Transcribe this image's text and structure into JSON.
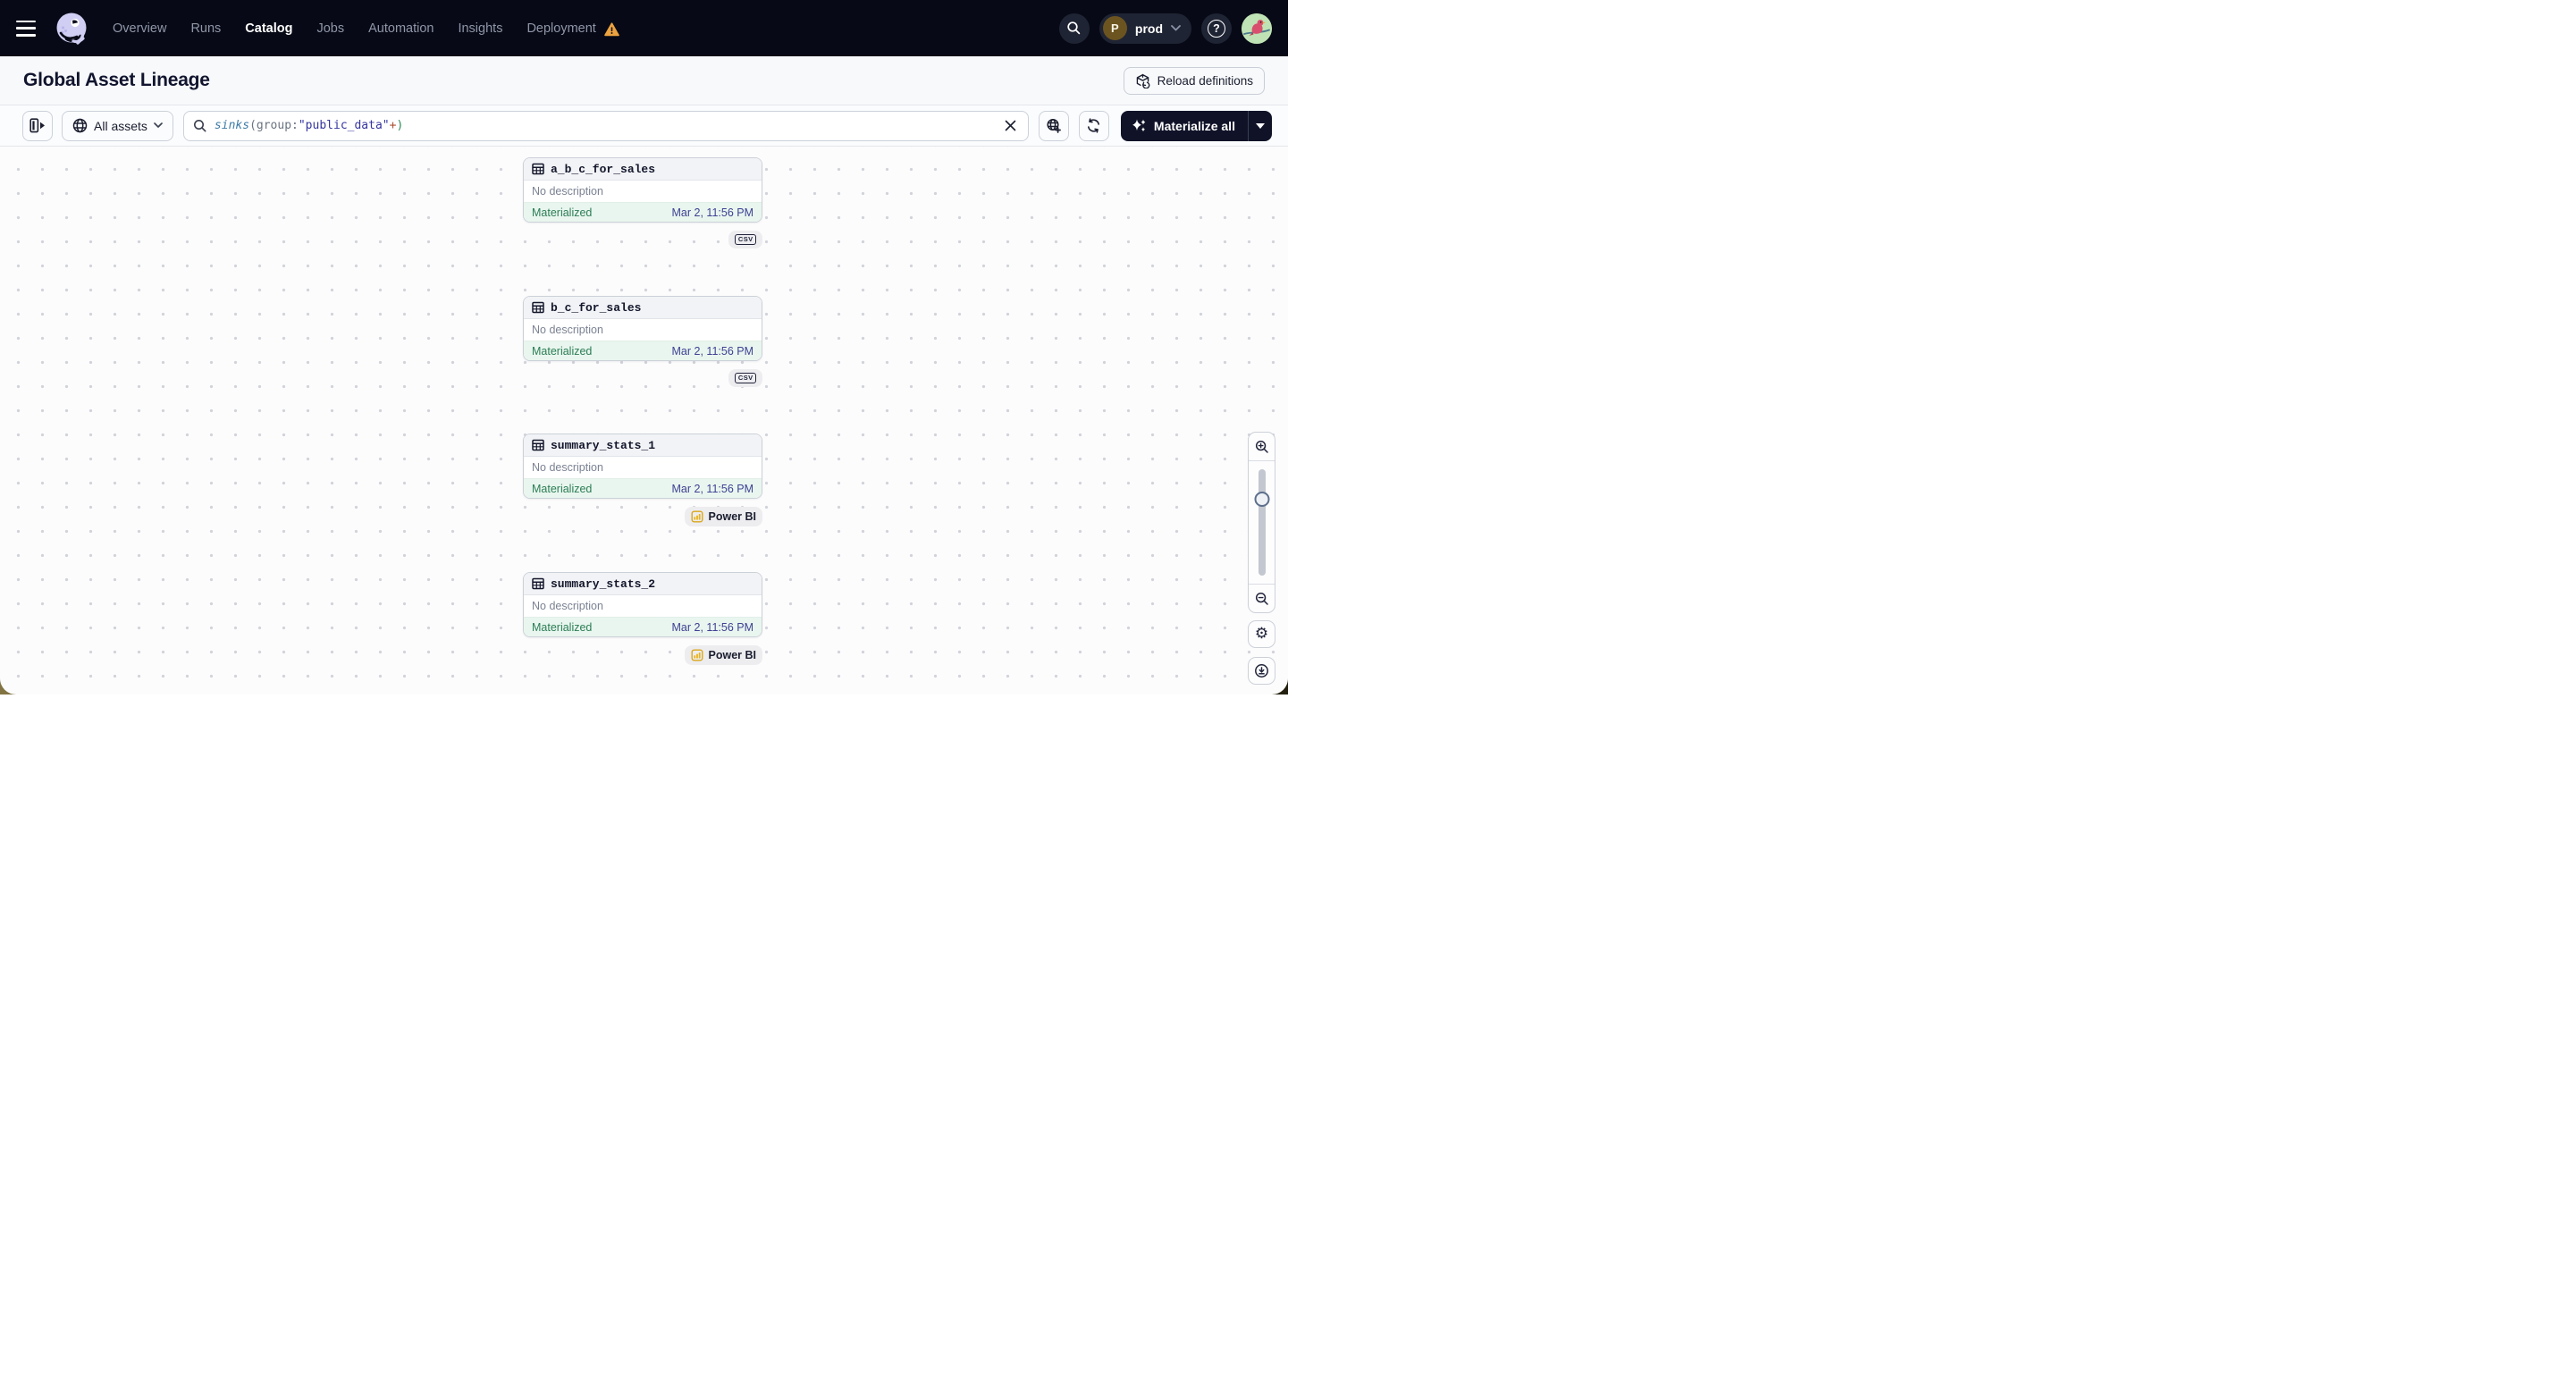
{
  "nav": {
    "items": [
      "Overview",
      "Runs",
      "Catalog",
      "Jobs",
      "Automation",
      "Insights",
      "Deployment"
    ],
    "active_item": "Catalog",
    "deployment_has_warning": true,
    "env_initial": "P",
    "env_label": "prod",
    "help_glyph": "?"
  },
  "page": {
    "title": "Global Asset Lineage",
    "reload_button": "Reload definitions"
  },
  "toolbar": {
    "scope_label": "All assets",
    "query_full": "sinks(group:\"public_data\"+)",
    "query": {
      "fn": "sinks",
      "open": "(",
      "key": "group",
      "colon": ":",
      "value": "\"public_data\"",
      "plus": "+",
      "close": ")"
    },
    "materialize_label": "Materialize all"
  },
  "nodes": [
    {
      "name": "a_b_c_for_sales",
      "description": "No description",
      "status": "Materialized",
      "timestamp": "Mar 2, 11:56 PM",
      "tag": "CSV"
    },
    {
      "name": "b_c_for_sales",
      "description": "No description",
      "status": "Materialized",
      "timestamp": "Mar 2, 11:56 PM",
      "tag": "CSV"
    },
    {
      "name": "summary_stats_1",
      "description": "No description",
      "status": "Materialized",
      "timestamp": "Mar 2, 11:56 PM",
      "tag": "Power BI"
    },
    {
      "name": "summary_stats_2",
      "description": "No description",
      "status": "Materialized",
      "timestamp": "Mar 2, 11:56 PM",
      "tag": "Power BI"
    }
  ],
  "tags": {
    "csv": "CSV",
    "powerbi": "Power BI"
  },
  "colors": {
    "nav_bg": "#070a16",
    "warning_amber": "#eda33f",
    "materialized_green": "#2b7d54",
    "materialized_bg": "#e9f6ef",
    "timestamp_indigo": "#3e4193",
    "powerbi_yellow": "#e9b31b",
    "env_avatar_brown": "#6c5420",
    "logo_lavender": "#d0cef2"
  }
}
